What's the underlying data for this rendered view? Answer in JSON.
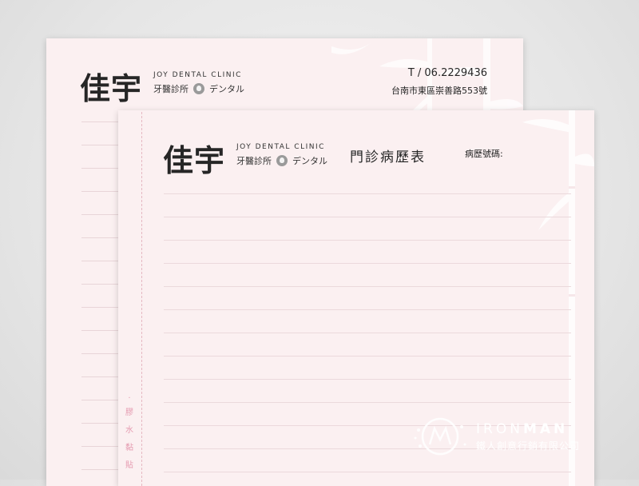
{
  "clinic": {
    "name_cn": "佳宇",
    "name_en": "JOY DENTAL CLINIC",
    "type_cn": "牙醫診所",
    "type_jp": "デンタル"
  },
  "back_sheet": {
    "phone": "T / 06.2229436",
    "address": "台南市東區崇善路553號"
  },
  "front_sheet": {
    "form_title": "門診病歷表",
    "record_no_label": "病歷號碼:",
    "stub_marks": [
      "膠",
      "水",
      "黏",
      "貼"
    ]
  },
  "watermark": {
    "brand_en_light": "IRON",
    "brand_en_bold": "MAN",
    "brand_cn": "鐵人創意行銷有限公司"
  },
  "colors": {
    "paper": "#fbf0f1",
    "rule": "#ebd9dc",
    "stub_accent": "#e59ab0",
    "text": "#262626"
  }
}
